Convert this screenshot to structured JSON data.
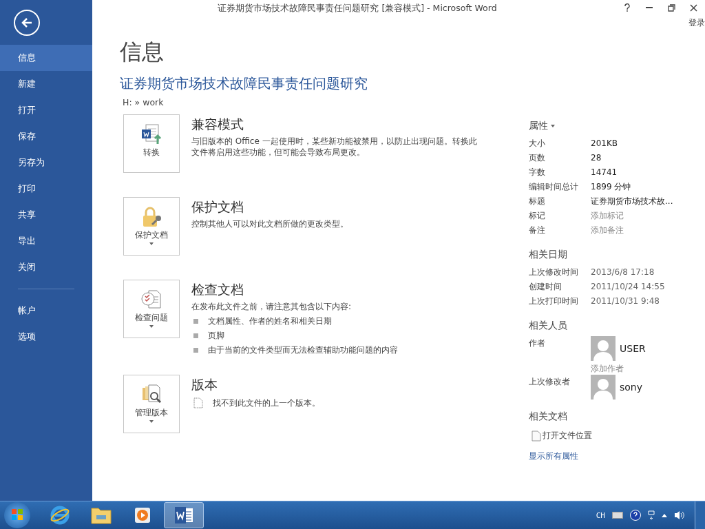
{
  "window": {
    "title": "证券期货市场技术故障民事责任问题研究 [兼容模式] - Microsoft Word",
    "sign_in": "登录"
  },
  "sidebar": {
    "items": [
      {
        "label": "信息",
        "selected": true
      },
      {
        "label": "新建",
        "selected": false
      },
      {
        "label": "打开",
        "selected": false
      },
      {
        "label": "保存",
        "selected": false
      },
      {
        "label": "另存为",
        "selected": false
      },
      {
        "label": "打印",
        "selected": false
      },
      {
        "label": "共享",
        "selected": false
      },
      {
        "label": "导出",
        "selected": false
      },
      {
        "label": "关闭",
        "selected": false
      }
    ],
    "footer_items": [
      {
        "label": "帐户",
        "selected": false
      },
      {
        "label": "选项",
        "selected": false
      }
    ]
  },
  "page": {
    "heading": "信息",
    "doc_title": "证券期货市场技术故障民事责任问题研究",
    "path": "H: » work"
  },
  "sections": [
    {
      "kind": "compat",
      "button_label": "转换",
      "dropdown": false,
      "title": "兼容模式",
      "description": "与旧版本的 Office 一起使用时，某些新功能被禁用，以防止出现问题。转换此文件将启用这些功能，但可能会导致布局更改。"
    },
    {
      "kind": "protect",
      "button_label": "保护文档",
      "dropdown": true,
      "title": "保护文档",
      "description": "控制其他人可以对此文档所做的更改类型。"
    },
    {
      "kind": "inspect",
      "button_label": "检查问题",
      "dropdown": true,
      "title": "检查文档",
      "description": "在发布此文件之前，请注意其包含以下内容:",
      "bullets": [
        "文档属性、作者的姓名和相关日期",
        "页脚",
        "由于当前的文件类型而无法检查辅助功能问题的内容"
      ]
    },
    {
      "kind": "versions",
      "button_label": "管理版本",
      "dropdown": true,
      "title": "版本",
      "note": "找不到此文件的上一个版本。"
    }
  ],
  "properties": {
    "heading": "属性",
    "rows": [
      {
        "label": "大小",
        "value": "201KB",
        "kind": "value"
      },
      {
        "label": "页数",
        "value": "28",
        "kind": "value"
      },
      {
        "label": "字数",
        "value": "14741",
        "kind": "value"
      },
      {
        "label": "编辑时间总计",
        "value": "1899 分钟",
        "kind": "value"
      },
      {
        "label": "标题",
        "value": "证券期货市场技术故...",
        "kind": "value"
      },
      {
        "label": "标记",
        "placeholder": "添加标记",
        "kind": "placeholder"
      },
      {
        "label": "备注",
        "placeholder": "添加备注",
        "kind": "placeholder"
      }
    ]
  },
  "dates": {
    "heading": "相关日期",
    "rows": [
      {
        "label": "上次修改时间",
        "value": "2013/6/8 17:18"
      },
      {
        "label": "创建时间",
        "value": "2011/10/24 14:55"
      },
      {
        "label": "上次打印时间",
        "value": "2011/10/31 9:48"
      }
    ]
  },
  "people": {
    "heading": "相关人员",
    "author_label": "作者",
    "author": "USER",
    "add_author": "添加作者",
    "modifier_label": "上次修改者",
    "modifier": "sony"
  },
  "related": {
    "heading": "相关文档",
    "open_location": "打开文件位置",
    "show_all": "显示所有属性"
  },
  "taskbar": {
    "apps": [
      {
        "kind": "ie",
        "selected": false
      },
      {
        "kind": "explorer",
        "selected": false
      },
      {
        "kind": "media",
        "selected": false
      },
      {
        "kind": "word",
        "selected": true
      }
    ],
    "language": "CH"
  }
}
